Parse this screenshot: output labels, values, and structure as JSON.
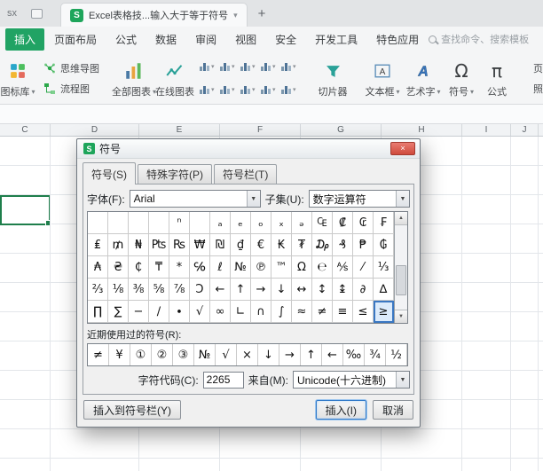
{
  "colors": {
    "wps_green": "#1ea55b",
    "menu_active_green": "#21a364",
    "selection_green": "#1e7e4b",
    "dialog_select_blue": "#3a77c2",
    "close_red": "#cf4a3c"
  },
  "icons": {
    "caret_down": "▾",
    "scroll_up": "▲",
    "scroll_down": "▼",
    "close": "×",
    "wps_logo": "S",
    "dialog_logo": "S",
    "omega": "Ω",
    "pi": "π"
  },
  "titlebar": {
    "previous_tab_fragment": "sx",
    "tab": {
      "title": "Excel表格技...输入大于等于符号"
    },
    "new_tab_button": "+"
  },
  "menubar": {
    "items": [
      {
        "label": "插入",
        "active": true
      },
      {
        "label": "页面布局",
        "active": false
      },
      {
        "label": "公式",
        "active": false
      },
      {
        "label": "数据",
        "active": false
      },
      {
        "label": "审阅",
        "active": false
      },
      {
        "label": "视图",
        "active": false
      },
      {
        "label": "安全",
        "active": false
      },
      {
        "label": "开发工具",
        "active": false
      },
      {
        "label": "特色应用",
        "active": false
      }
    ],
    "search_placeholder": "查找命令、搜索模板"
  },
  "ribbon": {
    "icon_library": "图标库",
    "mindmap": "思维导图",
    "flowchart": "流程图",
    "all_charts": "全部图表",
    "online_charts": "在线图表",
    "slicer": "切片器",
    "textbox": "文本框",
    "wordart": "艺术字",
    "symbol": "符号",
    "formula": "公式",
    "header_footer": "页眉页脚",
    "camera": "照相机"
  },
  "sheet": {
    "columns": [
      "C",
      "D",
      "E",
      "F",
      "G",
      "H",
      "I",
      "J"
    ]
  },
  "dialog": {
    "title": "符号",
    "tabs": [
      {
        "label": "符号(S)",
        "active": true
      },
      {
        "label": "特殊字符(P)",
        "active": false
      },
      {
        "label": "符号栏(T)",
        "active": false
      }
    ],
    "font_label": "字体(F):",
    "font_value": "Arial",
    "subset_label": "子集(U):",
    "subset_value": "数字运算符",
    "symbol_grid": {
      "rows": [
        [
          "",
          "",
          "",
          "",
          "ⁿ",
          "",
          "ₐ",
          "ₑ",
          "ₒ",
          "ₓ",
          "ₔ",
          "₠",
          "₡",
          "₢",
          "₣"
        ],
        [
          "₤",
          "₥",
          "₦",
          "₧",
          "₨",
          "₩",
          "₪",
          "₫",
          "€",
          "₭",
          "₮",
          "₯",
          "₰",
          "₱",
          "₲"
        ],
        [
          "₳",
          "₴",
          "₵",
          "₸",
          "*",
          "℅",
          "ℓ",
          "№",
          "℗",
          "™",
          "Ω",
          "℮",
          "⅍",
          "⁄",
          "⅓"
        ],
        [
          "⅔",
          "⅛",
          "⅜",
          "⅝",
          "⅞",
          "Ↄ",
          "←",
          "↑",
          "→",
          "↓",
          "↔",
          "↕",
          "↨",
          "∂",
          "∆"
        ],
        [
          "∏",
          "∑",
          "−",
          "∕",
          "∙",
          "√",
          "∞",
          "∟",
          "∩",
          "∫",
          "≈",
          "≠",
          "≡",
          "≤",
          "≥"
        ]
      ],
      "selected": "≥"
    },
    "recent_label": "近期使用过的符号(R):",
    "recent_symbols": [
      "≠",
      "¥",
      "①",
      "②",
      "③",
      "№",
      "√",
      "×",
      "↓",
      "→",
      "↑",
      "←",
      "‰",
      "¾",
      "½"
    ],
    "char_code_label": "字符代码(C):",
    "char_code_value": "2265",
    "from_label": "来自(M):",
    "from_value": "Unicode(十六进制)",
    "buttons": {
      "insert_to_symbol_bar": "插入到符号栏(Y)",
      "insert": "插入(I)",
      "cancel": "取消"
    }
  }
}
